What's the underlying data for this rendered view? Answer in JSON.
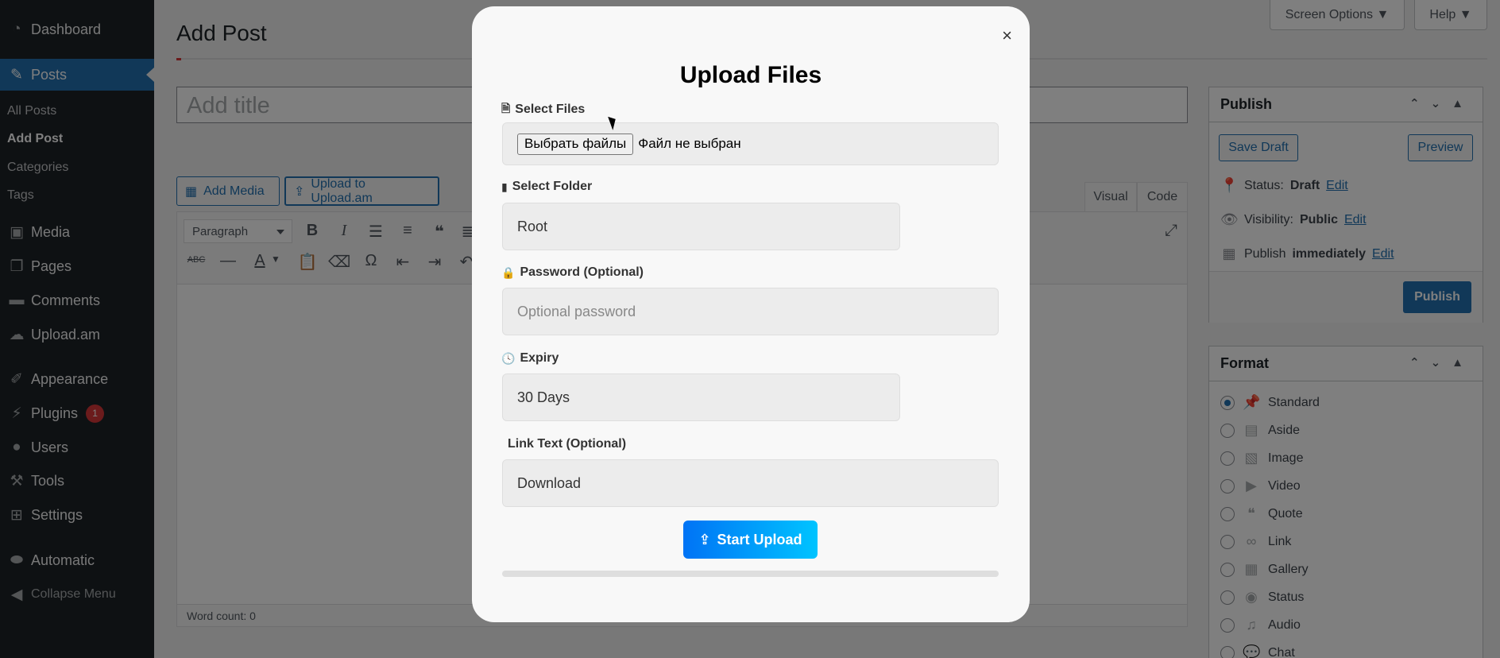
{
  "sidebar": {
    "dashboard": "Dashboard",
    "posts": "Posts",
    "sub": {
      "all_posts": "All Posts",
      "add_post": "Add Post",
      "categories": "Categories",
      "tags": "Tags"
    },
    "media": "Media",
    "pages": "Pages",
    "comments": "Comments",
    "uploadam": "Upload.am",
    "appearance": "Appearance",
    "plugins": "Plugins",
    "plugins_badge": "1",
    "users": "Users",
    "tools": "Tools",
    "settings": "Settings",
    "automatic": "Automatic",
    "collapse": "Collapse Menu"
  },
  "header": {
    "title": "Add Post",
    "screen_options": "Screen Options ▼",
    "help": "Help ▼"
  },
  "editor": {
    "title_placeholder": "Add title",
    "add_media": "Add Media",
    "upload_button": "Upload to Upload.am",
    "tab_visual": "Visual",
    "tab_code": "Code",
    "paragraph": "Paragraph",
    "word_count": "Word count: 0"
  },
  "publish": {
    "heading": "Publish",
    "save_draft": "Save Draft",
    "preview": "Preview",
    "status_label": "Status:",
    "status_value": "Draft",
    "visibility_label": "Visibility:",
    "visibility_value": "Public",
    "publish_label": "Publish",
    "publish_value": "immediately",
    "edit": "Edit",
    "publish_button": "Publish"
  },
  "format": {
    "heading": "Format",
    "options": [
      "Standard",
      "Aside",
      "Image",
      "Video",
      "Quote",
      "Link",
      "Gallery",
      "Status",
      "Audio",
      "Chat"
    ],
    "selected": "Standard"
  },
  "modal": {
    "title": "Upload Files",
    "close": "×",
    "select_files_label": "Select Files",
    "file_button": "Выбрать файлы",
    "file_status": "Файл не выбран",
    "folder_label": "Select Folder",
    "folder_value": "Root",
    "password_label": "Password (Optional)",
    "password_placeholder": "Optional password",
    "expiry_label": "Expiry",
    "expiry_value": "30 Days",
    "link_label": "Link Text (Optional)",
    "link_value": "Download",
    "start_button": "Start Upload",
    "progress": 0
  },
  "colors": {
    "accent": "#2271b1",
    "sidebar": "#1d2327",
    "upload_gradient_start": "#0073f5",
    "upload_gradient_end": "#00c4ff"
  }
}
